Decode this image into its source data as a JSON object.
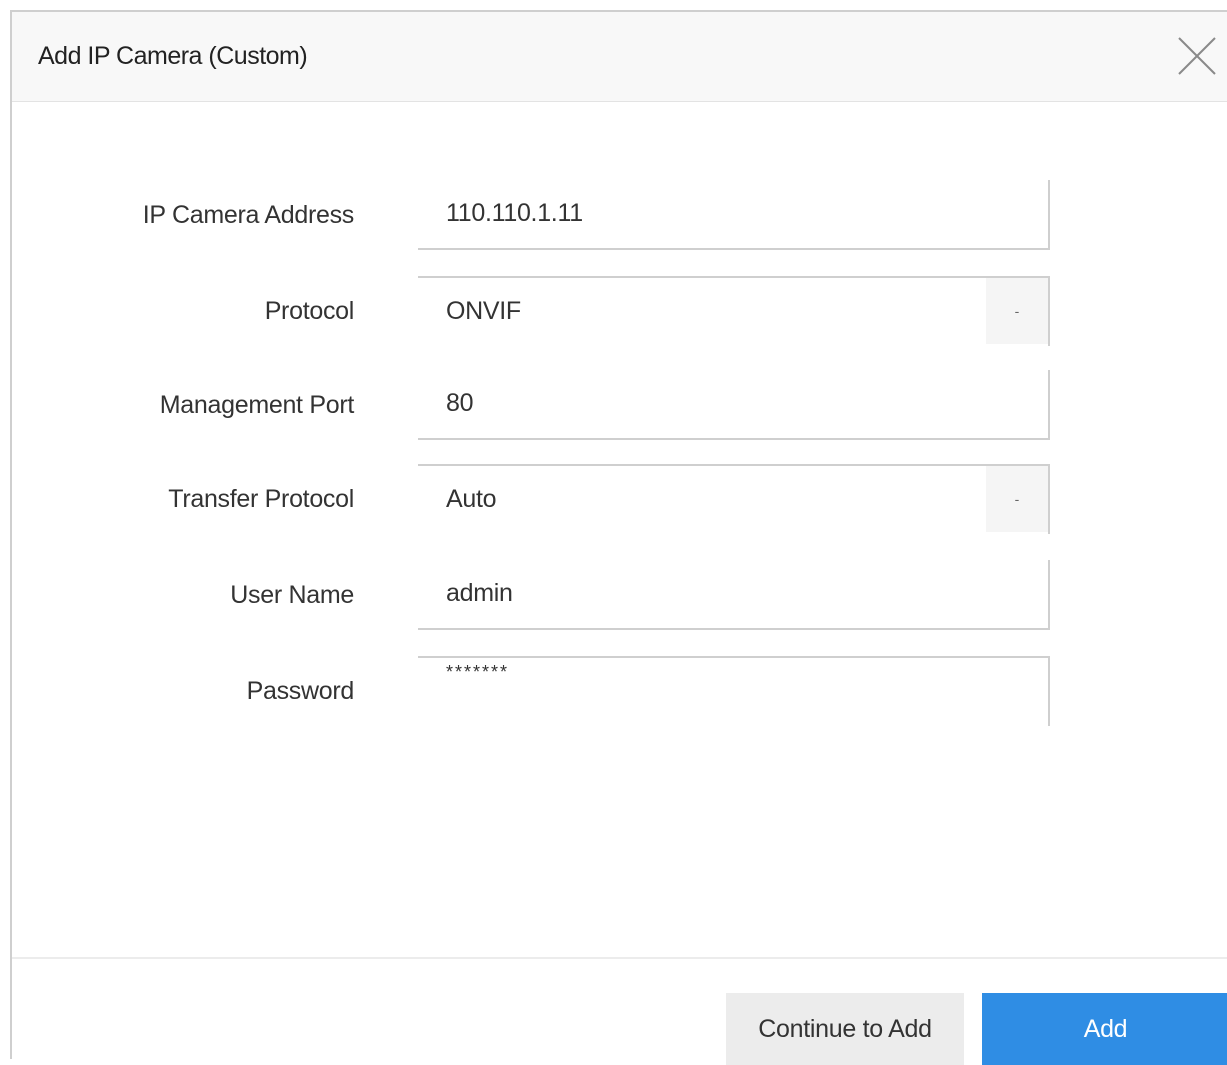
{
  "dialog": {
    "title": "Add IP Camera (Custom)"
  },
  "form": {
    "ip_address": {
      "label": "IP Camera Address",
      "value": "110.110.1.11"
    },
    "protocol": {
      "label": "Protocol",
      "value": "ONVIF",
      "arrow": "-"
    },
    "management_port": {
      "label": "Management Port",
      "value": "80"
    },
    "transfer_protocol": {
      "label": "Transfer Protocol",
      "value": "Auto",
      "arrow": "-"
    },
    "user_name": {
      "label": "User Name",
      "value": "admin"
    },
    "password": {
      "label": "Password",
      "value": "*******"
    }
  },
  "buttons": {
    "continue_label": "Continue to Add",
    "add_label": "Add"
  },
  "colors": {
    "accent": "#2f8de4",
    "header_bg": "#f8f8f8",
    "secondary_button": "#ececec"
  },
  "icons": {
    "close": "close-icon"
  }
}
